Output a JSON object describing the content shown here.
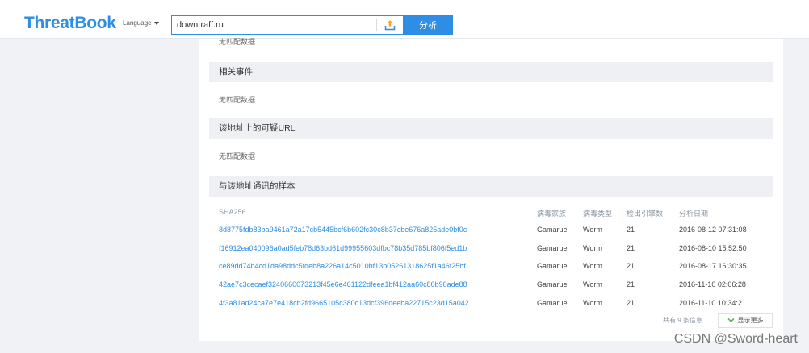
{
  "header": {
    "logo": "ThreatBook",
    "language_label": "Language",
    "search_value": "downtraff.ru",
    "analyze_label": "分析"
  },
  "sections": {
    "top_no_data": "无匹配数据",
    "related_events": {
      "title": "相关事件",
      "empty": "无匹配数据"
    },
    "suspicious_url": {
      "title": "该地址上的可疑URL",
      "empty": "无匹配数据"
    },
    "samples": {
      "title": "与该地址通讯的样本",
      "columns": {
        "sha256": "SHA256",
        "family": "病毒家族",
        "type": "病毒类型",
        "engines": "检出引擎数",
        "date": "分析日期"
      },
      "rows": [
        {
          "sha256": "8d8775fdb83ba9461a72a17cb5445bcf6b602fc30c8b37cbe676a825ade0bf0c",
          "family": "Gamarue",
          "type": "Worm",
          "engines": "21",
          "date": "2016-08-12 07:31:08"
        },
        {
          "sha256": "f16912ea040096a0ad5feb78d63bd61d99955603dfbc78b35d785bf806f5ed1b",
          "family": "Gamarue",
          "type": "Worm",
          "engines": "21",
          "date": "2016-08-10 15:52:50"
        },
        {
          "sha256": "ce89dd74b4cd1da98ddc5fdeb8a226a14c5010bf13b05261318625f1a46f25bf",
          "family": "Gamarue",
          "type": "Worm",
          "engines": "21",
          "date": "2016-08-17 16:30:35"
        },
        {
          "sha256": "42ae7c3cecaef3240660073213f45e6e461122dfeea1bf412aa60c80b90ade88",
          "family": "Gamarue",
          "type": "Worm",
          "engines": "21",
          "date": "2016-11-10 02:06:28"
        },
        {
          "sha256": "4f3a81ad24ca7e7e418cb2fd9665105c380c13dcf396deeba22715c23d15a042",
          "family": "Gamarue",
          "type": "Worm",
          "engines": "21",
          "date": "2016-11-10 10:34:21"
        }
      ],
      "footer_count": "共有 9 条信息",
      "show_more_label": "显示更多"
    }
  },
  "watermark": "CSDN @Sword-heart",
  "colors": {
    "brand": "#2e8ee6",
    "section_bg": "#eef0f3",
    "page_bg": "#f0f2f5"
  },
  "icons": {
    "upload": "upload-icon",
    "caret": "caret-down-icon",
    "show_more": "chevron-down-icon"
  }
}
